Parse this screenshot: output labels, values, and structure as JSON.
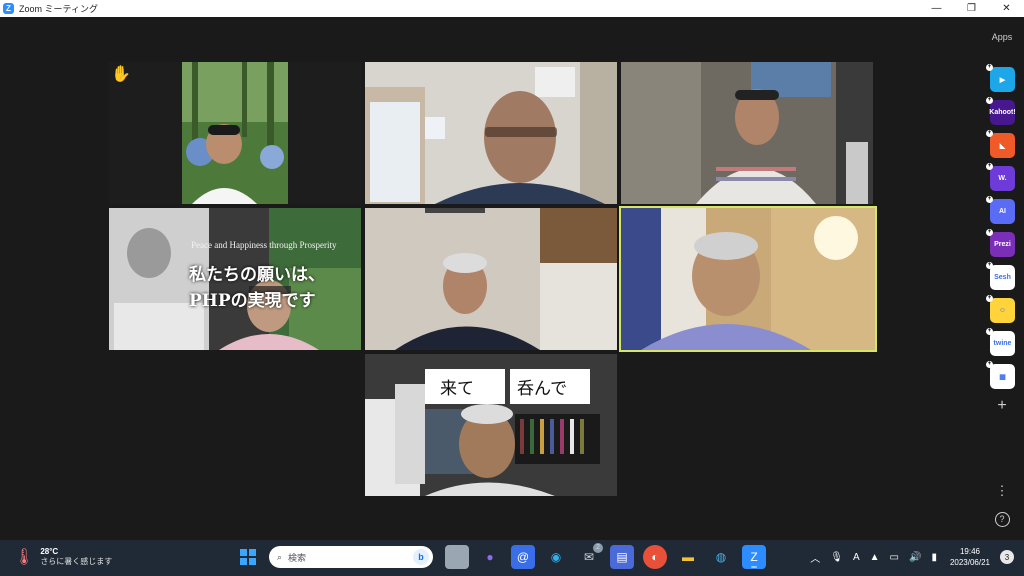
{
  "window": {
    "title": "Zoom ミーティング",
    "logo": "Z",
    "minimize": "—",
    "restore": "❐",
    "close": "✕"
  },
  "rail": {
    "title": "Apps",
    "apps": [
      {
        "name": "app-1",
        "label": "▶",
        "color": "#1ea7e8"
      },
      {
        "name": "app-kahoot",
        "label": "Kahoot!",
        "color": "#46178f"
      },
      {
        "name": "app-3",
        "label": "◣",
        "color": "#f05a28"
      },
      {
        "name": "app-wooclap",
        "label": "W.",
        "color": "#6e3bd8"
      },
      {
        "name": "app-ai",
        "label": "AI",
        "color": "#5a6cf5"
      },
      {
        "name": "app-prezi",
        "label": "Prezi",
        "color": "#7b2fb8"
      },
      {
        "name": "app-sesh",
        "label": "Sesh",
        "color": "#ffffff"
      },
      {
        "name": "app-emoji",
        "label": "☺",
        "color": "#ffd43b"
      },
      {
        "name": "app-twine",
        "label": "twine",
        "color": "#ffffff"
      },
      {
        "name": "app-grid",
        "label": "▦",
        "color": "#ffffff"
      }
    ],
    "add": "+",
    "more": "⋮",
    "help": "?"
  },
  "tiles": {
    "t1": {
      "raise_hand": "✋"
    },
    "t4": {
      "slide_en": "Peace and Happiness through Prosperity",
      "slide_ja_1": "私たちの願いは、",
      "slide_ja_2": "PHPの実現です"
    },
    "t8": {
      "sign_1": "来て",
      "sign_2": "呑んで"
    }
  },
  "taskbar": {
    "temp": "28°C",
    "weather": "さらに暑く感じます",
    "search_placeholder": "検索",
    "bing": "b",
    "chat_badge": "2",
    "clock_time": "19:46",
    "clock_date": "2023/06/21",
    "notif_count": "3"
  }
}
